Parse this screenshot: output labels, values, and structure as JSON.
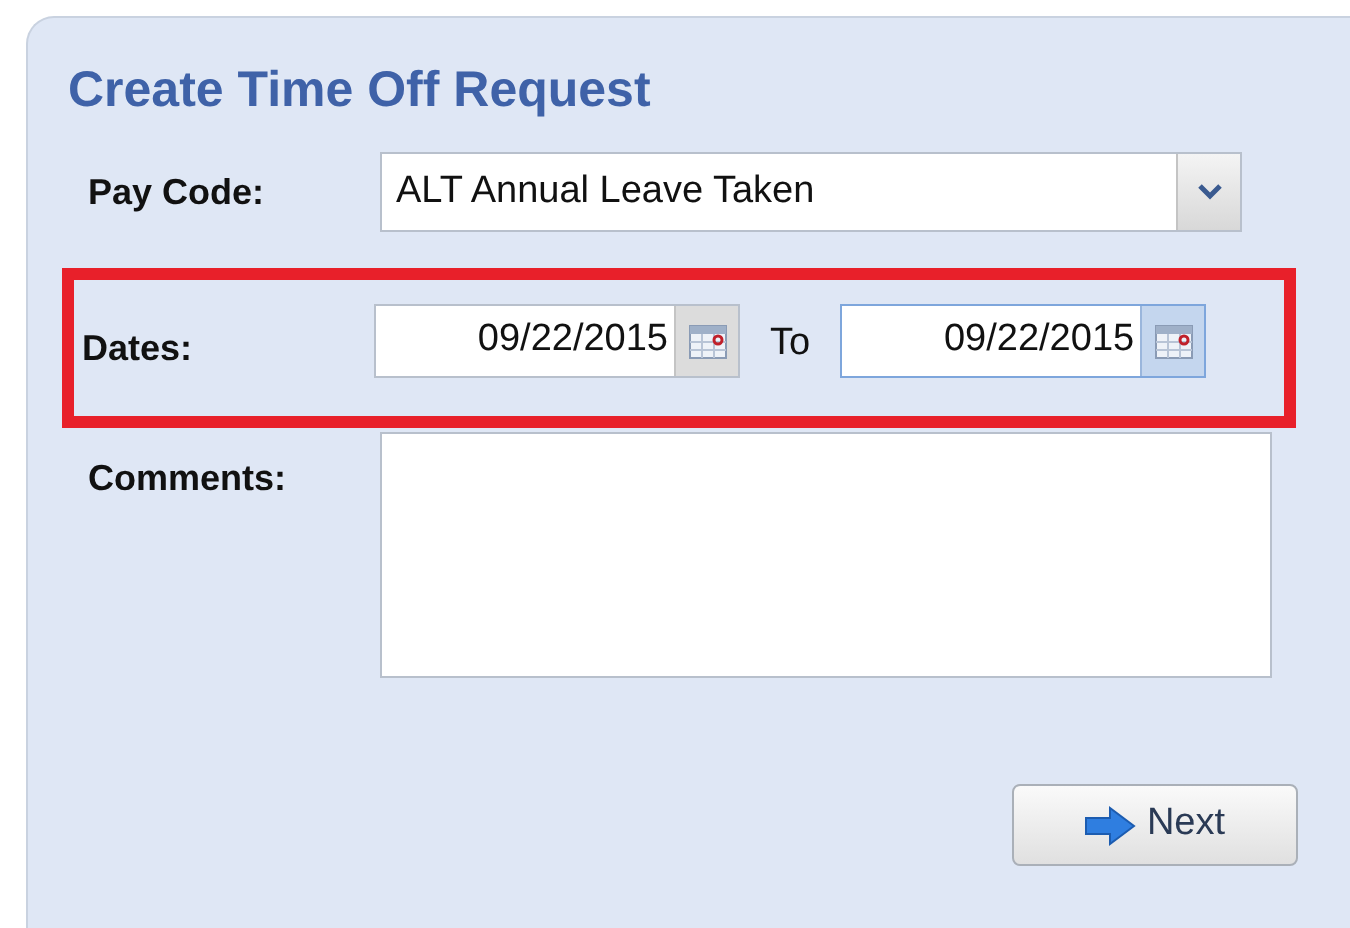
{
  "form": {
    "title": "Create Time Off Request",
    "pay_code": {
      "label": "Pay Code:",
      "value": "ALT Annual Leave Taken"
    },
    "dates": {
      "label": "Dates:",
      "highlighted": true,
      "fields": [
        {
          "value": "09/22/2015",
          "focused": false
        },
        {
          "separator": "To",
          "value": "09/22/2015",
          "focused": true
        }
      ]
    },
    "comments": {
      "label": "Comments:"
    },
    "buttons": [
      {
        "label": "Next"
      }
    ]
  }
}
